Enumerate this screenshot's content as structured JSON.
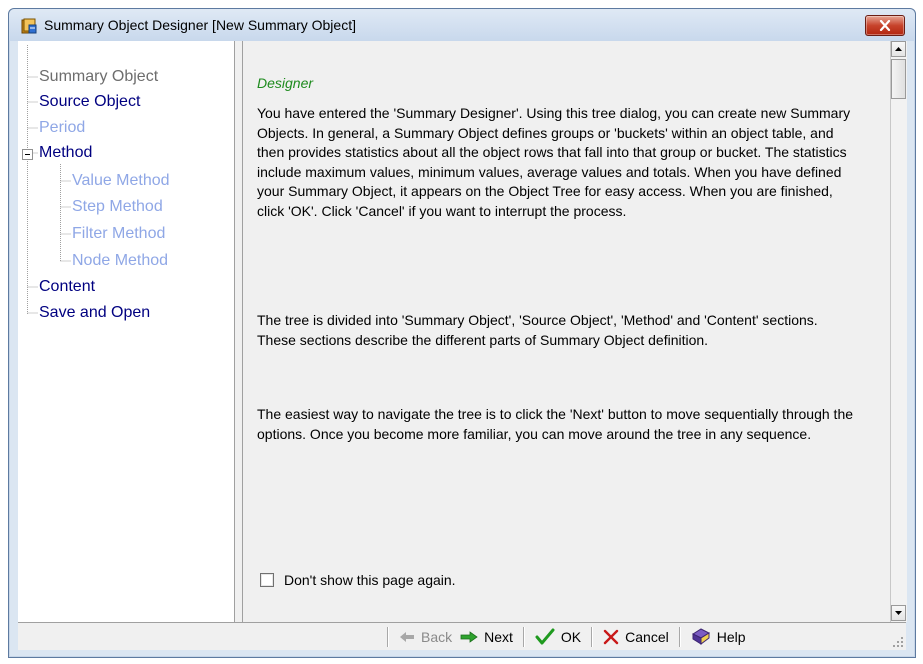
{
  "window": {
    "title": "Summary Object Designer [New Summary Object]"
  },
  "tree": {
    "items": [
      {
        "label": "Summary Object",
        "state": "selected"
      },
      {
        "label": "Source Object",
        "state": "active"
      },
      {
        "label": "Period",
        "state": "disabled"
      },
      {
        "label": "Method",
        "state": "active",
        "expander": "⊟"
      },
      {
        "label": "Value Method",
        "state": "disabled"
      },
      {
        "label": "Step Method",
        "state": "disabled"
      },
      {
        "label": "Filter Method",
        "state": "disabled"
      },
      {
        "label": "Node Method",
        "state": "disabled"
      },
      {
        "label": "Content",
        "state": "active"
      },
      {
        "label": "Save and Open",
        "state": "active"
      }
    ]
  },
  "content": {
    "section_title": "Designer",
    "paragraphs": [
      "You have entered the 'Summary Designer'. Using this tree dialog, you can create new Summary Objects. In general, a Summary Object defines groups or 'buckets' within an object table, and then provides statistics about all the object rows that fall into that group or bucket. The statistics include maximum values, minimum values, average values and totals. When you have defined your Summary Object, it appears on the Object Tree for easy access. When you are finished, click 'OK'. Click 'Cancel' if you want to interrupt the process.",
      "The tree is divided into 'Summary Object', 'Source Object', 'Method' and 'Content' sections. These sections describe the different parts of Summary Object definition.",
      "The easiest way to navigate the tree is to click the 'Next' button to move sequentially through the options. Once you become more familiar, you can move around the tree in any sequence."
    ],
    "checkbox_label": "Don't show this page again.",
    "checkbox_checked": false
  },
  "toolbar": {
    "back_label": "Back",
    "next_label": "Next",
    "ok_label": "OK",
    "cancel_label": "Cancel",
    "help_label": "Help"
  },
  "icons": {
    "app": "book-icon",
    "close": "close-icon",
    "back": "arrow-left-icon",
    "next": "arrow-right-icon",
    "ok": "checkmark-icon",
    "cancel": "x-icon",
    "help": "help-book-icon"
  },
  "colors": {
    "tree_active": "#000080",
    "tree_disabled": "#8fa7e6",
    "section_title": "#1e8b1e",
    "close_button": "#c7432c"
  }
}
